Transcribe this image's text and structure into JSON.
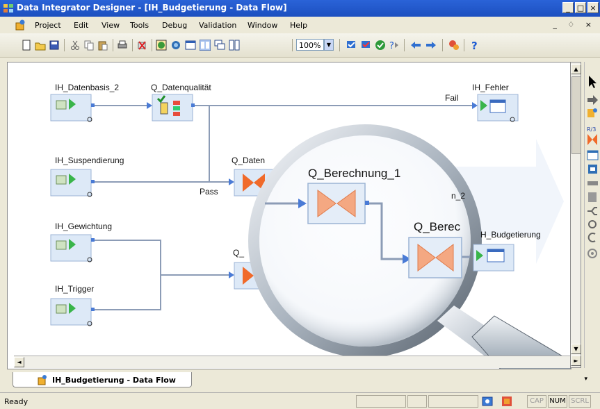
{
  "window": {
    "title": "Data Integrator Designer - [IH_Budgetierung - Data Flow]",
    "buttons": [
      "_",
      "□",
      "×"
    ]
  },
  "menu": {
    "items": [
      "Project",
      "Edit",
      "View",
      "Tools",
      "Debug",
      "Validation",
      "Window",
      "Help"
    ],
    "mdi_controls": "_ ♢ ×"
  },
  "toolbar": {
    "zoom": "100%"
  },
  "diagram": {
    "nodes": {
      "datenbasis": "IH_Datenbasis_2",
      "datenqualitaet": "Q_Datenqualität",
      "fehler": "IH_Fehler",
      "suspendierung": "IH_Suspendierung",
      "q_daten": "Q_Daten",
      "q_berechnung_1": "Q_Berechnung_1",
      "q_berec": "Q_Berec",
      "n_2": "n_2",
      "budgetierung": "H_Budgetierung",
      "gewichtung": "IH_Gewichtung",
      "trigger": "IH_Trigger",
      "q_partial": "Q_"
    },
    "links": {
      "fail": "Fail",
      "pass": "Pass"
    }
  },
  "tab": {
    "label": "IH_Budgetierung - Data Flow"
  },
  "status": {
    "text": "Ready",
    "cap": "CAP",
    "num": "NUM",
    "scrl": "SCRL"
  }
}
